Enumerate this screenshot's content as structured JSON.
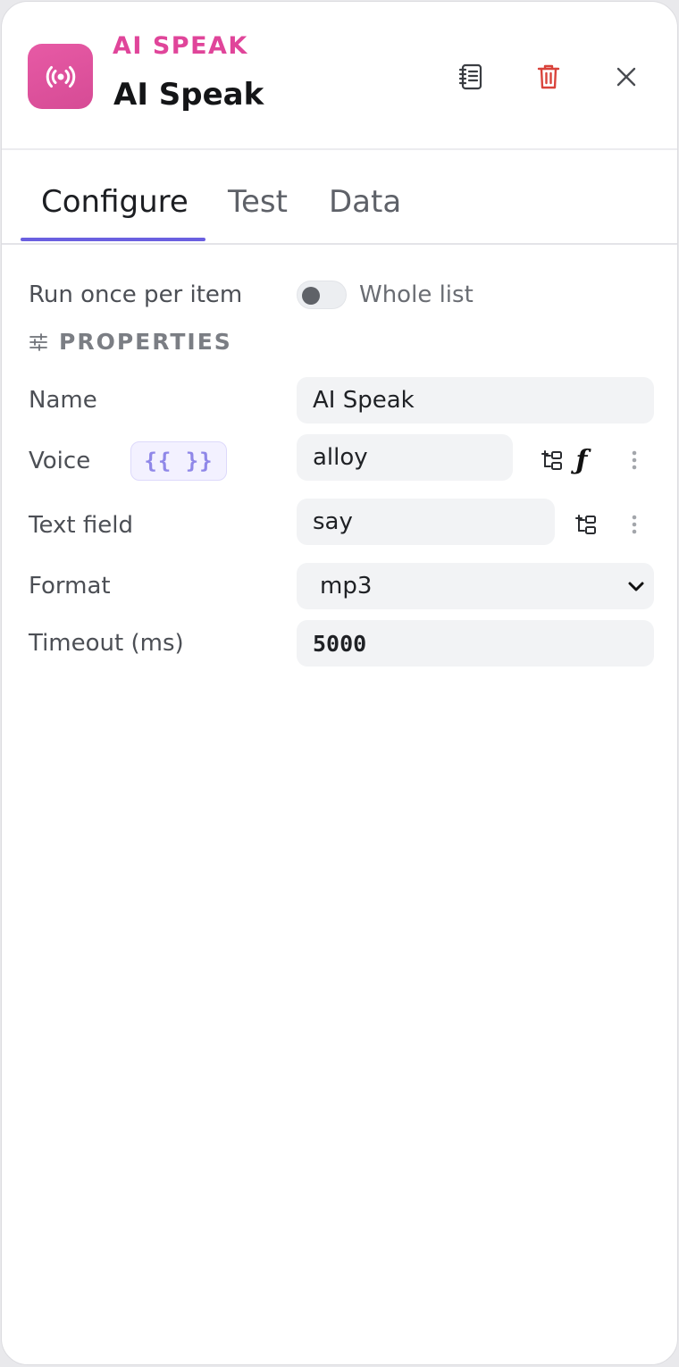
{
  "header": {
    "kicker": "AI SPEAK",
    "title": "AI Speak",
    "app_icon": "broadcast-icon",
    "actions": [
      "notes-icon",
      "trash-icon",
      "close-icon"
    ],
    "accent_color": "#e0459a",
    "danger_color": "#d9433b"
  },
  "tabs": [
    {
      "label": "Configure",
      "active": true
    },
    {
      "label": "Test",
      "active": false
    },
    {
      "label": "Data",
      "active": false
    }
  ],
  "tab_underline_color": "#6a5fe0",
  "mode": {
    "label": "Run once per item",
    "toggle_on": false,
    "toggle_label": "Whole list"
  },
  "properties": {
    "heading": "PROPERTIES",
    "fields": {
      "name": {
        "label": "Name",
        "value": "AI Speak"
      },
      "voice": {
        "label": "Voice",
        "template_chip": "{{ }}",
        "value": "alloy",
        "fx_label": "ƒ"
      },
      "text_field": {
        "label": "Text field",
        "value": "say"
      },
      "format": {
        "label": "Format",
        "value": "mp3"
      },
      "timeout": {
        "label": "Timeout (ms)",
        "value": "5000"
      }
    }
  }
}
